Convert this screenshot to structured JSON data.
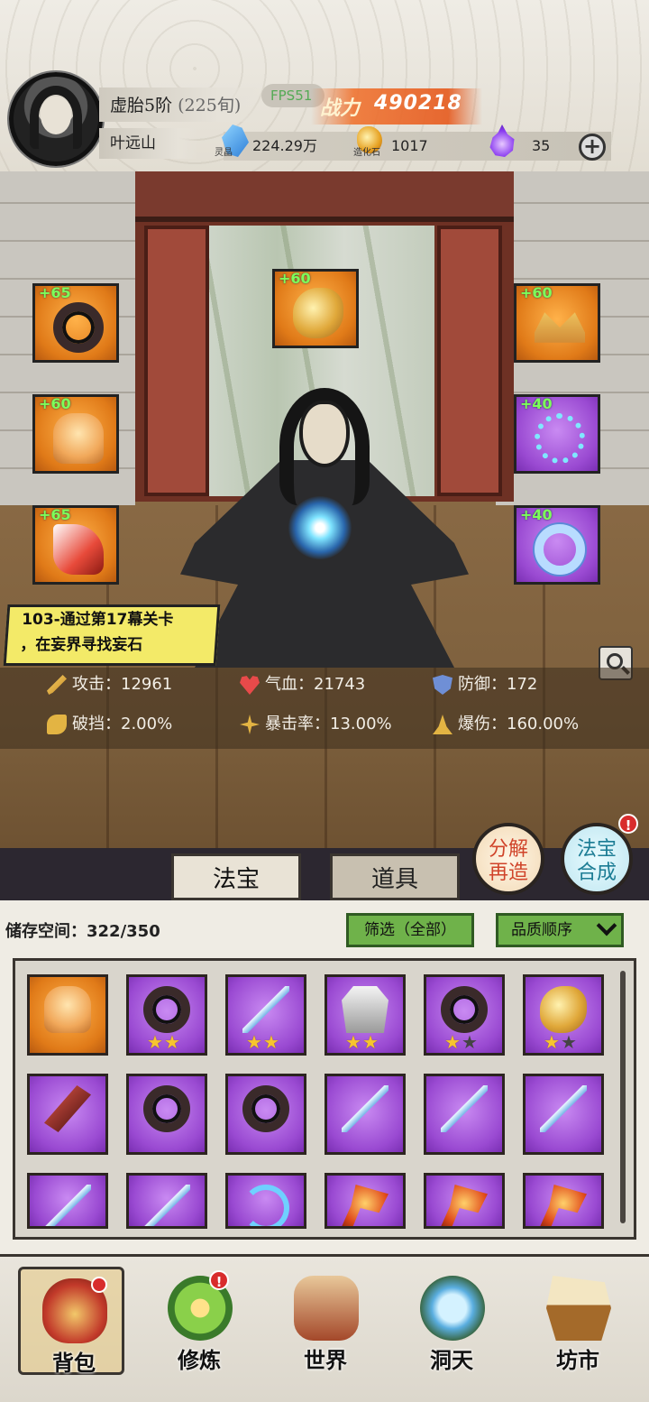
{
  "player": {
    "realm": "虚胎5阶",
    "age": "(225旬)",
    "name": "叶远山",
    "fps": "FPS51",
    "power_label": "战力",
    "power_value": "490218"
  },
  "resources": [
    {
      "icon": "spirit-crystal-icon",
      "sub": "灵晶",
      "value": "224.29万"
    },
    {
      "icon": "creation-stone-icon",
      "sub": "造化石",
      "value": "1017"
    },
    {
      "icon": "purple-flame-icon",
      "sub": "",
      "value": "35"
    }
  ],
  "equipment": [
    {
      "slot": "left-1",
      "level": "+65",
      "quality": "orange",
      "icon": "chakram-icon"
    },
    {
      "slot": "left-2",
      "level": "+60",
      "quality": "orange",
      "icon": "armor-icon"
    },
    {
      "slot": "left-3",
      "level": "+65",
      "quality": "orange",
      "icon": "boots-icon"
    },
    {
      "slot": "center",
      "level": "+60",
      "quality": "orange",
      "icon": "dragon-pendant-icon"
    },
    {
      "slot": "right-1",
      "level": "+60",
      "quality": "orange",
      "icon": "crown-icon"
    },
    {
      "slot": "right-2",
      "level": "+40",
      "quality": "purple",
      "icon": "necklace-icon"
    },
    {
      "slot": "right-3",
      "level": "+40",
      "quality": "purple",
      "icon": "bracelet-icon"
    }
  ],
  "quest": {
    "line1": "103-通过第17幕关卡",
    "line2": "，在妄界寻找妄石"
  },
  "stats": {
    "attack": "攻击：12961",
    "hp": "气血：21743",
    "defense": "防御：172",
    "break": "破挡：2.00%",
    "crit_rate": "暴击率：13.00%",
    "crit_damage": "爆伤：160.00%"
  },
  "tabs": {
    "artifact": "法宝",
    "items": "道具"
  },
  "actions": {
    "decompose_line1": "分解",
    "decompose_line2": "再造",
    "synth_line1": "法宝",
    "synth_line2": "合成",
    "alert": "!"
  },
  "inventory": {
    "storage": "储存空间：322/350",
    "filter": "筛选（全部）",
    "sort": "品质顺序",
    "items": [
      {
        "quality": "orange",
        "icon": "armor-icon",
        "stars": 0
      },
      {
        "quality": "purple",
        "icon": "chakram-icon",
        "stars": 2,
        "max": 2
      },
      {
        "quality": "purple",
        "icon": "sword-icon",
        "stars": 2,
        "max": 2
      },
      {
        "quality": "purple",
        "icon": "robe-icon",
        "stars": 2,
        "max": 2
      },
      {
        "quality": "purple",
        "icon": "chakram-icon",
        "stars": 1,
        "max": 2
      },
      {
        "quality": "purple",
        "icon": "dragon-pendant-icon",
        "stars": 1,
        "max": 2
      },
      {
        "quality": "purple",
        "icon": "dagger-icon",
        "stars": 0
      },
      {
        "quality": "purple",
        "icon": "chakram-icon",
        "stars": 0
      },
      {
        "quality": "purple",
        "icon": "chakram-icon",
        "stars": 0
      },
      {
        "quality": "purple",
        "icon": "sword-icon",
        "stars": 0
      },
      {
        "quality": "purple",
        "icon": "sword-icon",
        "stars": 0
      },
      {
        "quality": "purple",
        "icon": "sword-icon",
        "stars": 0
      },
      {
        "quality": "purple",
        "icon": "sword-icon",
        "stars": 0
      },
      {
        "quality": "purple",
        "icon": "sword-icon",
        "stars": 0
      },
      {
        "quality": "purple",
        "icon": "bow-icon",
        "stars": 0
      },
      {
        "quality": "purple",
        "icon": "axe-icon",
        "stars": 0
      },
      {
        "quality": "purple",
        "icon": "axe-icon",
        "stars": 0
      },
      {
        "quality": "purple",
        "icon": "axe-icon",
        "stars": 0
      }
    ]
  },
  "nav": [
    {
      "label": "背包",
      "icon": "bag-icon",
      "selected": true
    },
    {
      "label": "修炼",
      "icon": "flower-icon",
      "alert": true
    },
    {
      "label": "世界",
      "icon": "scroll-icon"
    },
    {
      "label": "洞天",
      "icon": "portal-icon"
    },
    {
      "label": "坊市",
      "icon": "shop-icon"
    }
  ],
  "colors": {
    "orange_quality": "#e07a18",
    "purple_quality": "#9a4ad2",
    "level_green": "#7dff5a",
    "button_green": "#6fb24a",
    "quest_yellow": "#f3ea68"
  }
}
